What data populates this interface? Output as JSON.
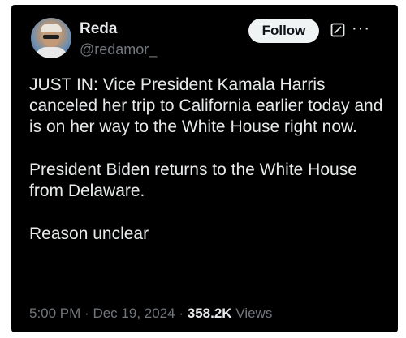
{
  "author": {
    "display_name": "Reda",
    "handle": "@redamor_"
  },
  "actions": {
    "follow_label": "Follow"
  },
  "tweet": {
    "paragraphs": [
      "JUST IN: Vice President Kamala Harris canceled her trip to California earlier today and is on her way to the White House right now.",
      "President Biden returns to the White House from Delaware.",
      "Reason unclear"
    ]
  },
  "meta": {
    "time": "5:00 PM",
    "separator": "·",
    "date": "Dec 19, 2024",
    "views_count": "358.2K",
    "views_label": "Views"
  },
  "icons": {
    "grok": "grok-icon",
    "more": "more-icon"
  },
  "colors": {
    "background": "#000000",
    "text_primary": "#e7e9ea",
    "text_secondary": "#71767b",
    "follow_bg": "#eff3f4"
  }
}
